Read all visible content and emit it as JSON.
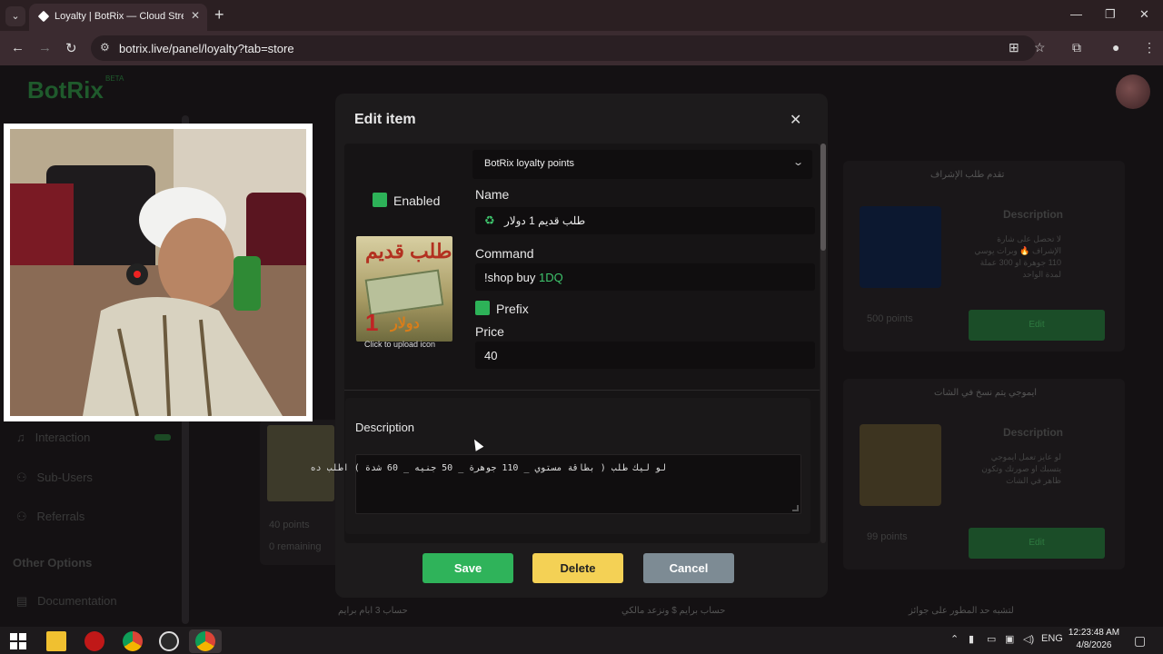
{
  "browser": {
    "tab_title": "Loyalty | BotRix — Cloud Stream",
    "url": "botrix.live/panel/loyalty?tab=store"
  },
  "page": {
    "logo": "BotRix",
    "logo_badge": "BETA",
    "sidebar": {
      "items": [
        "Interaction",
        "Sub-Users",
        "Referrals"
      ],
      "section": "Other Options",
      "doc": "Documentation"
    },
    "cards": [
      {
        "title": "تقدم طلب الإشراف",
        "desc_heading": "Description",
        "desc": "لا تحصل على شارة الإشراف 🔥 وبرات يوسي 110 جوهرة او 300 عملة لمدة الواحد",
        "points": "500 points",
        "button": "Edit"
      },
      {
        "title": "ايموجي يتم نسخ في الشات",
        "desc_heading": "Description",
        "desc": "لو عايز تعمل ايموجي يتسبك او صورتك وتكون ظاهر في الشات",
        "points": "99 points",
        "button": "Edit"
      }
    ],
    "bg_item": {
      "points": "40 points",
      "remaining": "0 remaining"
    },
    "bottom": [
      "حساب 3 ابام برايم",
      "حساب برايم $ ونزعد مالكي",
      "لتشبه حد المطور على جوائز"
    ]
  },
  "modal": {
    "title": "Edit item",
    "currency": "BotRix loyalty points",
    "enabled_label": "Enabled",
    "name_label": "Name",
    "name_value": "طلب قديم 1 دولار",
    "command_label": "Command",
    "command_prefix": "!shop buy ",
    "command_code": "1DQ",
    "prefix_label": "Prefix",
    "price_label": "Price",
    "price_value": "40",
    "upload_label": "Click to upload icon",
    "image_text_top": "طلب قديم",
    "image_text_num": "1",
    "image_text_bottom": "دولار",
    "description_label": "Description",
    "description_value": "لو ليك طلب ( بطاقة مستوي _ 110 جوهرة _ 50 جنيه _ 60 شدة ) اطلب ده",
    "buttons": {
      "save": "Save",
      "delete": "Delete",
      "cancel": "Cancel"
    }
  },
  "taskbar": {
    "lang": "ENG",
    "time": "12:23:48 AM",
    "date": "4/8/2026"
  },
  "colors": {
    "accent_green": "#2fb35a",
    "delete_yellow": "#f4d155",
    "cancel_gray": "#7d8b94"
  }
}
